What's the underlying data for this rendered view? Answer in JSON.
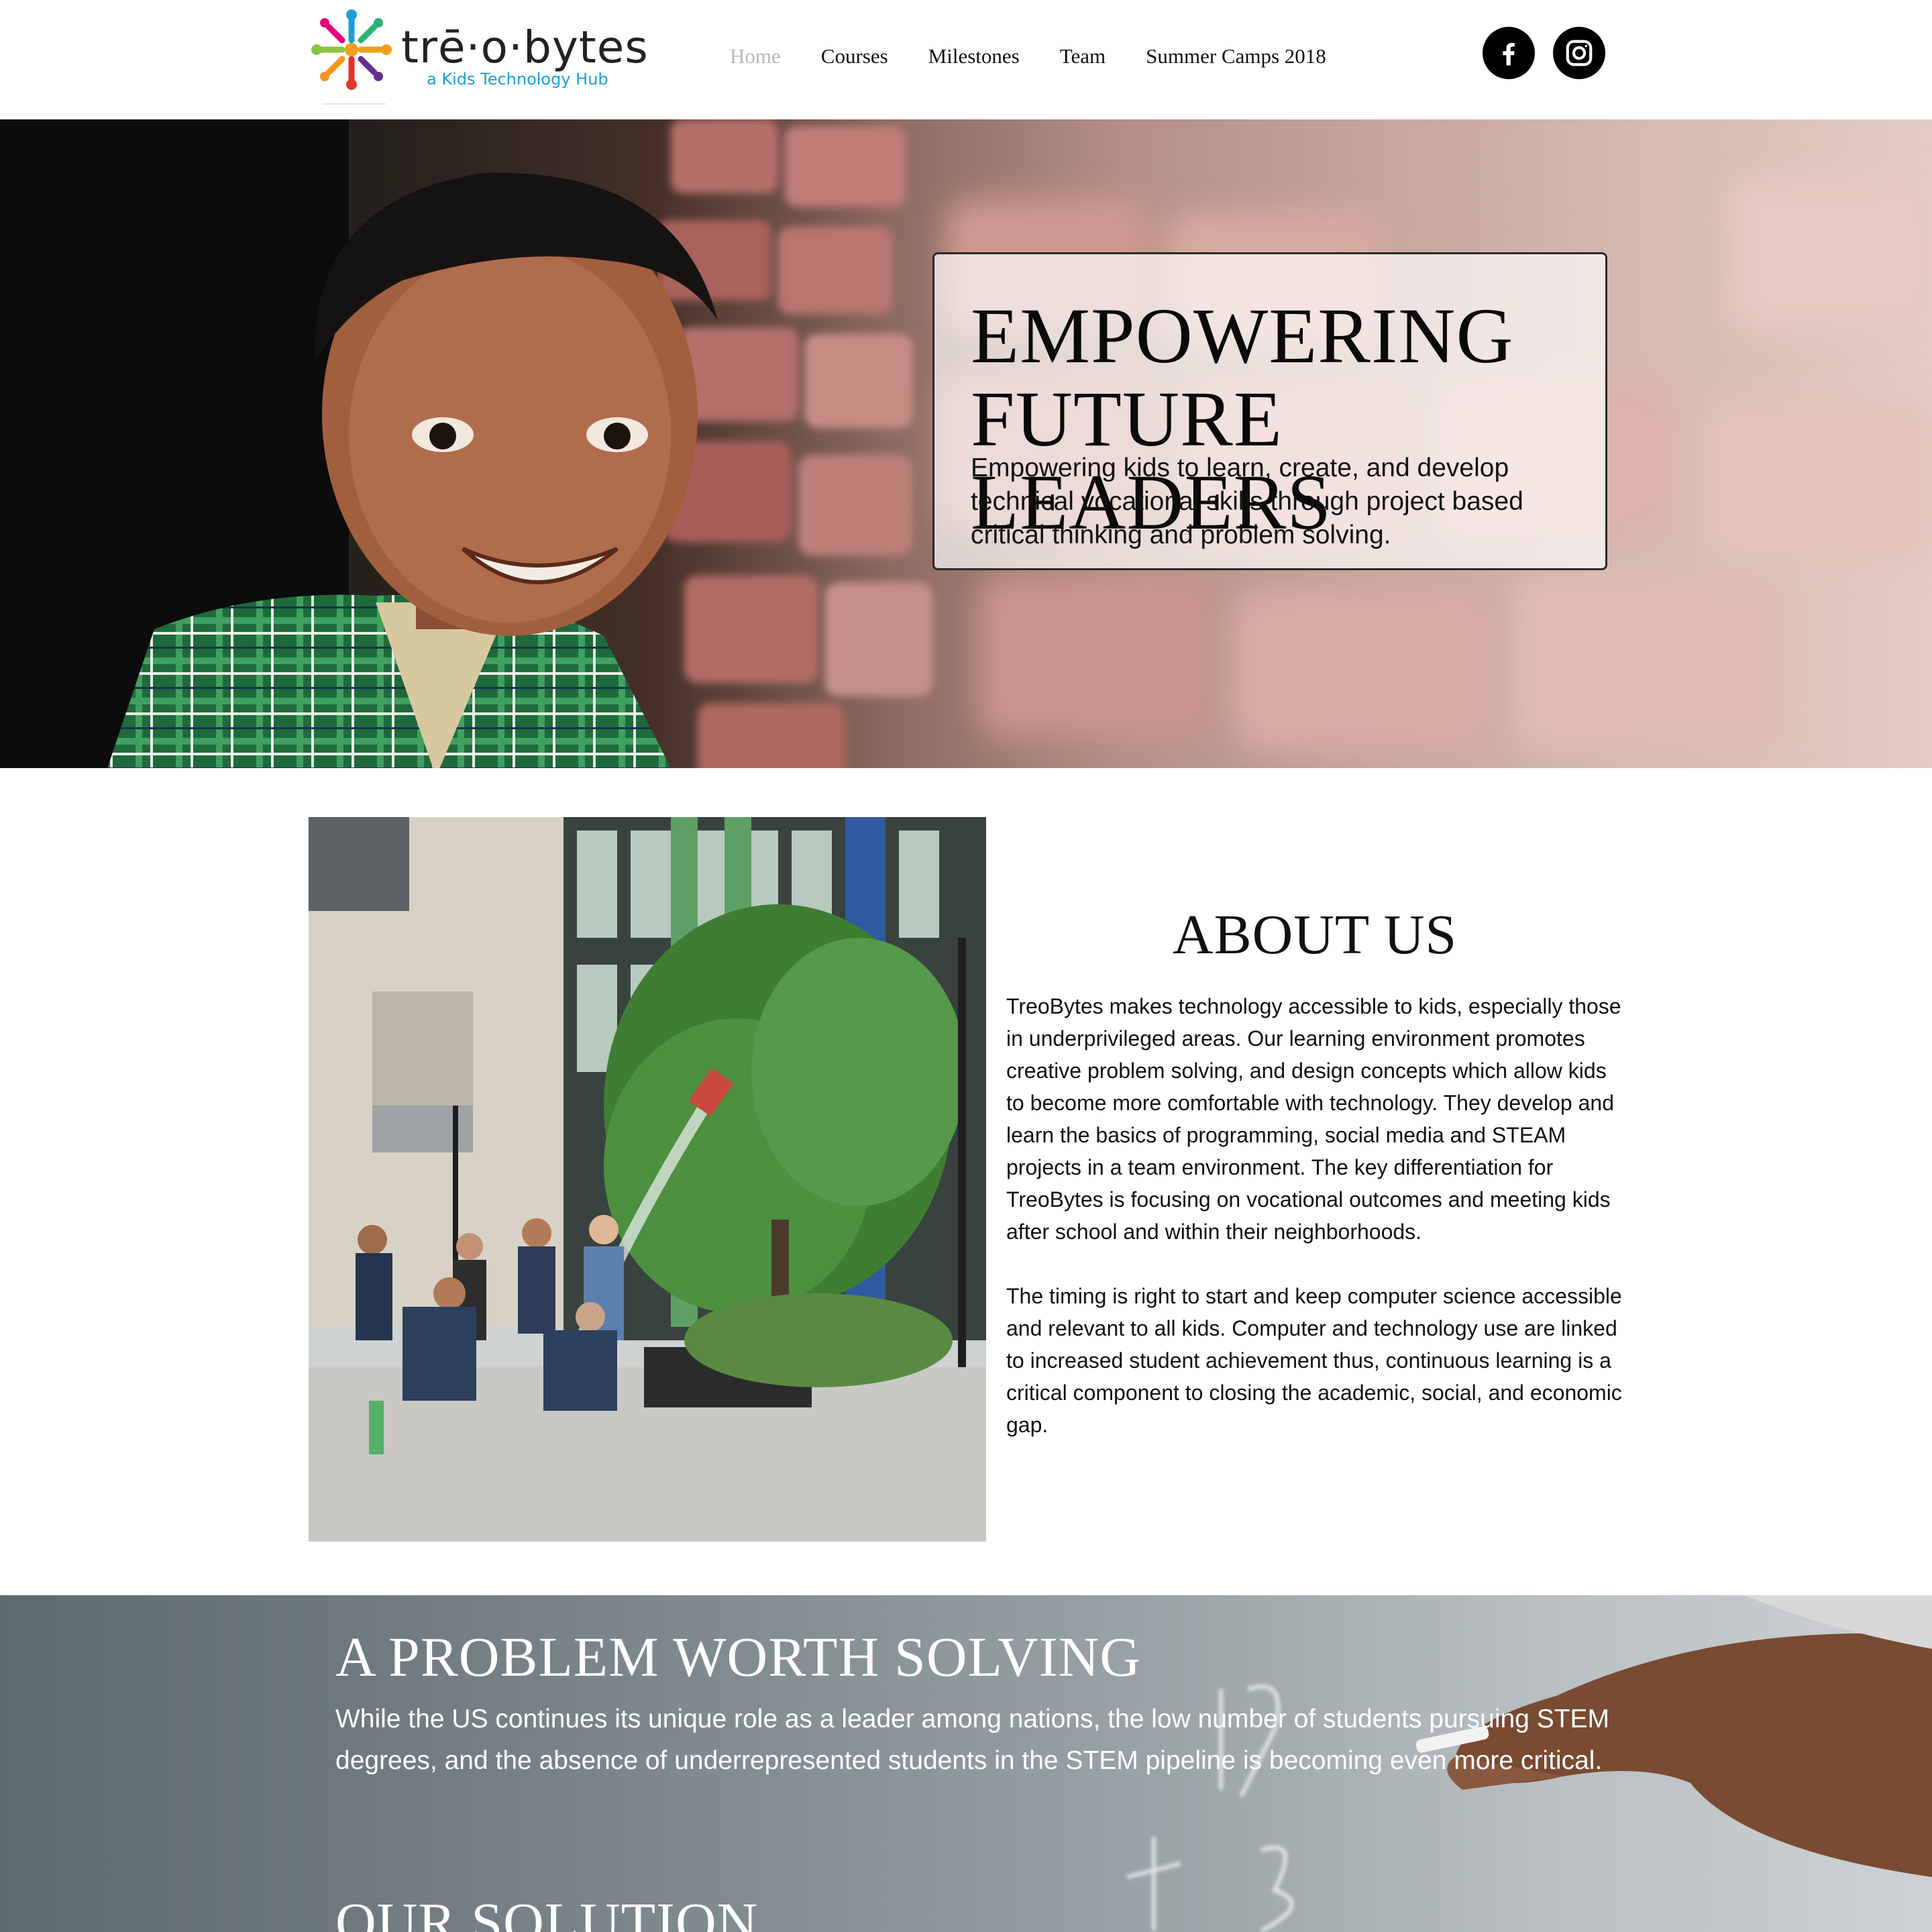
{
  "header": {
    "logo_word": "trē·o·bytes",
    "logo_tagline": "a Kids Technology  Hub",
    "nav": [
      {
        "label": "Home",
        "active": true
      },
      {
        "label": "Courses",
        "active": false
      },
      {
        "label": "Milestones",
        "active": false
      },
      {
        "label": "Team",
        "active": false
      },
      {
        "label": "Summer Camps 2018",
        "active": false
      }
    ],
    "social": [
      {
        "icon": "facebook-icon"
      },
      {
        "icon": "instagram-icon"
      }
    ]
  },
  "hero": {
    "title": "EMPOWERING FUTURE LEADERS",
    "subtitle": "Empowering kids to learn, create, and develop technical vocational skills through project based critical thinking and problem solving."
  },
  "about": {
    "title": "ABOUT US",
    "paragraph1": "TreoBytes makes technology accessible to kids, especially those in underprivileged areas. Our learning environment promotes creative problem solving, and design concepts which allow kids to become more comfortable with technology. They develop and learn the basics of programming, social media and STEAM projects in a team environment. The key differentiation for TreoBytes is focusing on vocational outcomes and meeting kids after school and within their neighborhoods.",
    "paragraph2": "The timing is right to start and keep computer science accessible and relevant to all kids. Computer and technology use are linked to increased student achievement thus, continuous learning is a critical component to closing the academic, social, and economic gap."
  },
  "problem": {
    "title": "A PROBLEM WORTH SOLVING",
    "text": "While the US continues its unique role as a leader among nations, the low number of students pursuing STEM degrees, and the absence of underrepresented students in the STEM pipeline is becoming even more critical.",
    "solution_title": "OUR SOLUTION"
  },
  "colors": {
    "nav_active": "#b8b8b8",
    "logo_tagline": "#1d9fd8",
    "text": "#111111"
  }
}
